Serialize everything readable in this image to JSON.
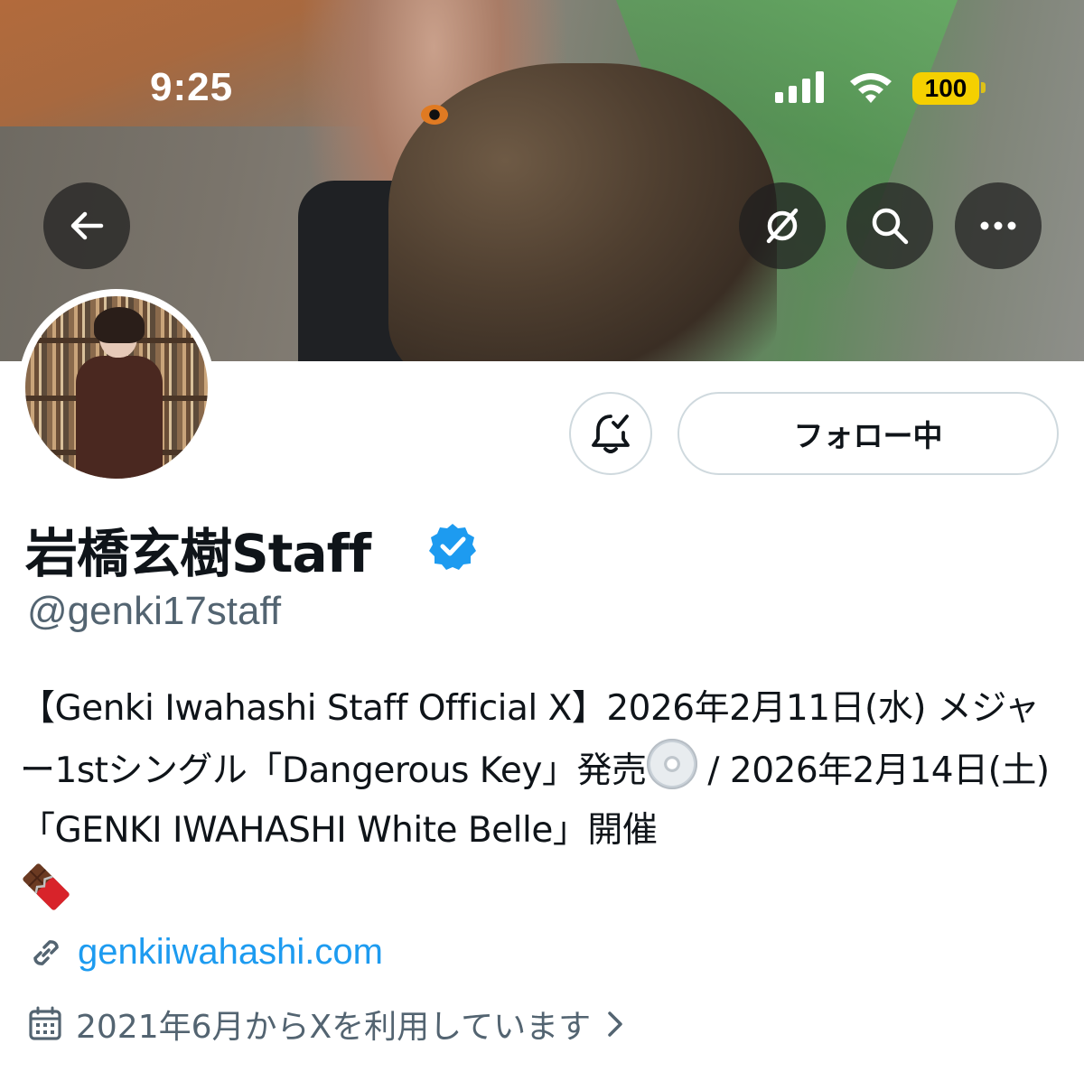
{
  "status_bar": {
    "time": "9:25",
    "battery": "100",
    "battery_color": "#f5d000"
  },
  "header": {
    "back_icon": "arrow-left-icon",
    "grok_icon": "grok-icon",
    "search_icon": "search-icon",
    "more_icon": "more-horizontal-icon"
  },
  "profile": {
    "display_name": "岩橋玄樹Staff",
    "verified": true,
    "verified_color": "#1d9bf0",
    "handle": "@genki17staff",
    "bio_part1": "【Genki Iwahashi Staff Official X】2026年2月11日(水) メジャー1stシングル「Dangerous Key」発売",
    "bio_part2": " / 2026年2月14日(土)「GENKI IWAHASHI White Belle」開催",
    "bio_emoji_1": "disc-emoji",
    "bio_emoji_2": "chocolate-emoji",
    "website": "genkiiwahashi.com",
    "joined": "2021年6月からXを利用しています"
  },
  "actions": {
    "notify_icon": "bell-check-icon",
    "follow_label": "フォロー中"
  },
  "colors": {
    "link": "#1d9bf0",
    "secondary_text": "#536471",
    "border": "#cfd9de"
  }
}
